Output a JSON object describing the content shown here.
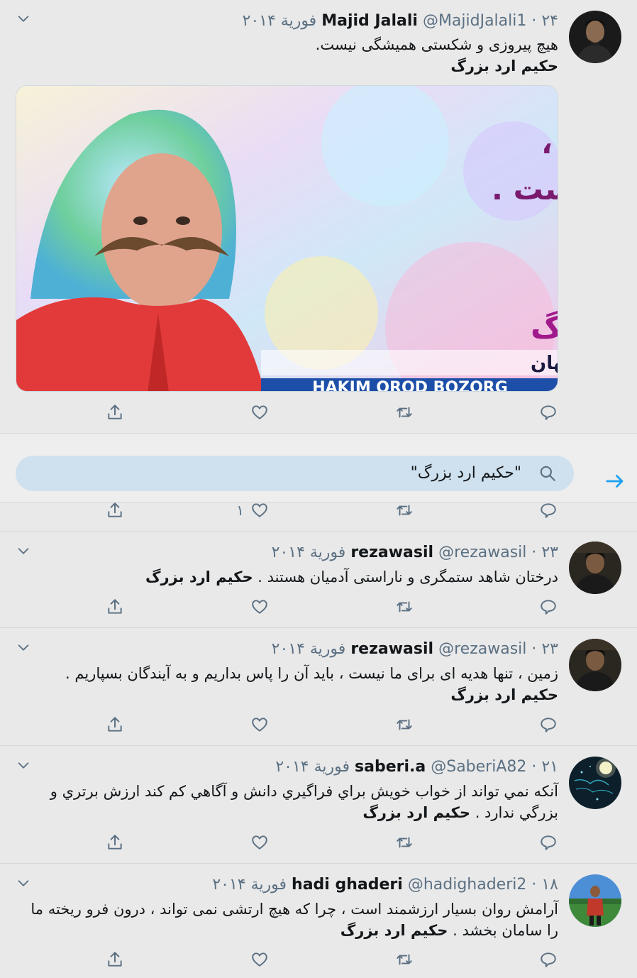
{
  "colors": {
    "accent": "#1da1f2",
    "muted": "#5b7083",
    "background": "#e9e9e9"
  },
  "tweets": [
    {
      "name": "Majid Jalali",
      "meta": "@MajidJalali1 · ۲۴ فورية ۲۰۱۴",
      "text": "هیچ پیروزی و شکستی همیشگی نیست.",
      "hashtag": "حکیم ارد بزرگ",
      "media": {
        "line1": "هیچ پیروزی و شکستی ،",
        "line2": "همیشگی نیست .",
        "title": "حکیم اُرُد بزرگ",
        "subtitle": "بزرگترین فیلسوف جهان",
        "latin": "HAKIM OROD BOZORG"
      }
    },
    {
      "name": "rezawasil",
      "meta": "@rezawasil · ۲۳ فورية ۲۰۱۴",
      "text": "درختان شاهد ستمگری و ناراستی آدمیان هستند .",
      "hashtag": "حکیم ارد بزرگ"
    },
    {
      "name": "rezawasil",
      "meta": "@rezawasil · ۲۳ فورية ۲۰۱۴",
      "text": "زمین ، تنها هدیه ای برای ما نیست ، باید آن را پاس بداریم و به آیندگان بسپاریم .",
      "hashtag": "حکیم ارد بزرگ"
    },
    {
      "name": "saberi.a",
      "meta": "@SaberiA82 · ۲۱ فورية ۲۰۱۴",
      "text": "آنکه نمي تواند از خواب خويش براي فراگيري دانش و آگاهي کم کند ارزش برتري و بزرگي ندارد .",
      "hashtag": "حکیم ارد بزرگ"
    },
    {
      "name": "hadi ghaderi",
      "meta": "@hadighaderi2 · ۱۸ فورية ۲۰۱۴",
      "text": "آرامش روان بسیار ارزشمند است ، چرا که هیچ ارتشی نمی تواند ، درون فرو ریخته ما را سامان بخشد .",
      "hashtag": "حکیم ارد بزرگ"
    }
  ],
  "search": {
    "query": "\"حکیم ارد بزرگ\""
  },
  "hidden_tweet": {
    "like_count": "۱"
  },
  "icons": [
    "chevron-down-icon",
    "share-icon",
    "like-icon",
    "retweet-icon",
    "reply-icon",
    "search-icon",
    "arrow-right-icon"
  ]
}
